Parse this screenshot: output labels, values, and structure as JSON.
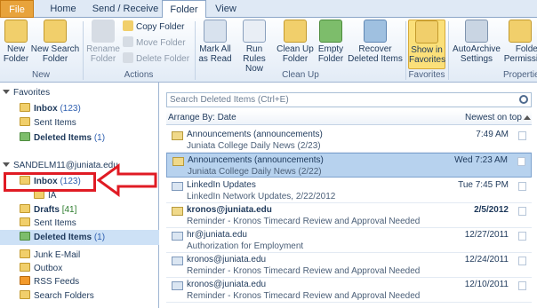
{
  "tabs": [
    "File",
    "Home",
    "Send / Receive",
    "Folder",
    "View"
  ],
  "ribbon": {
    "new_group": {
      "label": "New",
      "new_folder": "New Folder",
      "new_search_folder": "New Search Folder"
    },
    "actions_group": {
      "label": "Actions",
      "rename_folder": "Rename Folder",
      "copy_folder": "Copy Folder",
      "move_folder": "Move Folder",
      "delete_folder": "Delete Folder"
    },
    "cleanup_group": {
      "label": "Clean Up",
      "mark_all_read": "Mark All as Read",
      "run_rules_now": "Run Rules Now",
      "clean_up_folder": "Clean Up Folder",
      "empty_folder": "Empty Folder",
      "recover_deleted": "Recover Deleted Items"
    },
    "favorites_group": {
      "label": "Favorites",
      "show_in_favorites": "Show in Favorites"
    },
    "properties_group": {
      "label": "Properties",
      "autoarchive": "AutoArchive Settings",
      "folder_permissions": "Folder Permissions"
    }
  },
  "nav": {
    "favorites_header": "Favorites",
    "favorites": [
      {
        "label": "Inbox",
        "count": "(123)"
      },
      {
        "label": "Sent Items",
        "count": ""
      },
      {
        "label": "Deleted Items",
        "count": "(1)"
      }
    ],
    "account_header": "SANDELM11@juniata.edu",
    "folders": [
      {
        "label": "Inbox",
        "count": "(123)"
      },
      {
        "label": "IA",
        "count": ""
      },
      {
        "label": "Drafts",
        "count": "[41]"
      },
      {
        "label": "Sent Items",
        "count": ""
      },
      {
        "label": "Deleted Items",
        "count": "(1)"
      },
      {
        "label": "Junk E-Mail",
        "count": ""
      },
      {
        "label": "Outbox",
        "count": ""
      },
      {
        "label": "RSS Feeds",
        "count": ""
      },
      {
        "label": "Search Folders",
        "count": ""
      }
    ]
  },
  "list": {
    "search_placeholder": "Search Deleted Items (Ctrl+E)",
    "arrange_by": "Arrange By: Date",
    "sort_order": "Newest on top",
    "items": [
      {
        "sender": "Announcements (announcements)",
        "subject": "Juniata College Daily News (2/23)",
        "date": "7:49 AM"
      },
      {
        "sender": "Announcements (announcements)",
        "subject": "Juniata College Daily News (2/22)",
        "date": "Wed 7:23 AM"
      },
      {
        "sender": "LinkedIn Updates",
        "subject": "LinkedIn Network Updates, 2/22/2012",
        "date": "Tue 7:45 PM"
      },
      {
        "sender": "kronos@juniata.edu",
        "subject": "Reminder - Kronos Timecard Review and Approval Needed",
        "date": "2/5/2012"
      },
      {
        "sender": "hr@juniata.edu",
        "subject": "Authorization for Employment",
        "date": "12/27/2011"
      },
      {
        "sender": "kronos@juniata.edu",
        "subject": "Reminder - Kronos Timecard Review and Approval Needed",
        "date": "12/24/2011"
      },
      {
        "sender": "kronos@juniata.edu",
        "subject": "Reminder - Kronos Timecard Review and Approval Needed",
        "date": "12/10/2011"
      }
    ]
  },
  "colors": {
    "accent": "#e8a33b",
    "selection": "#b7d2ee",
    "annotation_red": "#e01b24"
  }
}
